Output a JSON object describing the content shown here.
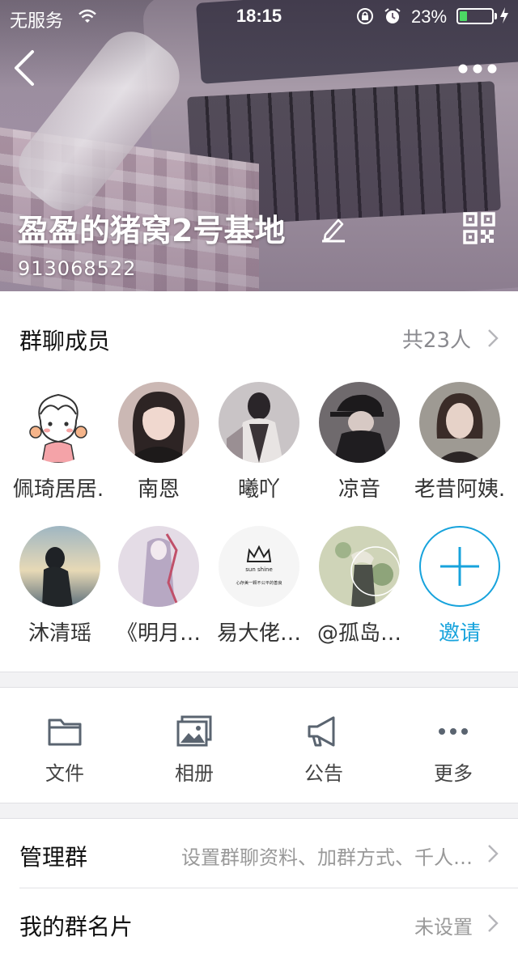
{
  "status_bar": {
    "carrier": "无服务",
    "time": "18:15",
    "battery_percent": "23%",
    "battery_level": 0.23
  },
  "header": {
    "group_name": "盈盈的猪窝2号基地",
    "group_id": "913068522"
  },
  "members": {
    "title": "群聊成员",
    "count": "共23人",
    "items": [
      {
        "name": "佩琦居居."
      },
      {
        "name": "南恩"
      },
      {
        "name": "曦吖"
      },
      {
        "name": "凉音"
      },
      {
        "name": "老昔阿姨."
      },
      {
        "name": "沐清瑶"
      },
      {
        "name": "《明月…"
      },
      {
        "name": "易大佬…"
      },
      {
        "name": "@孤岛…"
      }
    ],
    "invite_label": "邀请",
    "avatar_8_text_top": "sun shine",
    "avatar_8_text_bottom": "心存美一颗不公平的善良"
  },
  "actions": [
    {
      "label": "文件",
      "icon": "folder-icon"
    },
    {
      "label": "相册",
      "icon": "album-icon"
    },
    {
      "label": "公告",
      "icon": "megaphone-icon"
    },
    {
      "label": "更多",
      "icon": "more-dots-icon"
    }
  ],
  "settings": [
    {
      "title": "管理群",
      "value": "设置群聊资料、加群方式、千人…"
    },
    {
      "title": "我的群名片",
      "value": "未设置"
    }
  ],
  "colors": {
    "accent": "#17a3dc",
    "battery": "#4cd964"
  }
}
